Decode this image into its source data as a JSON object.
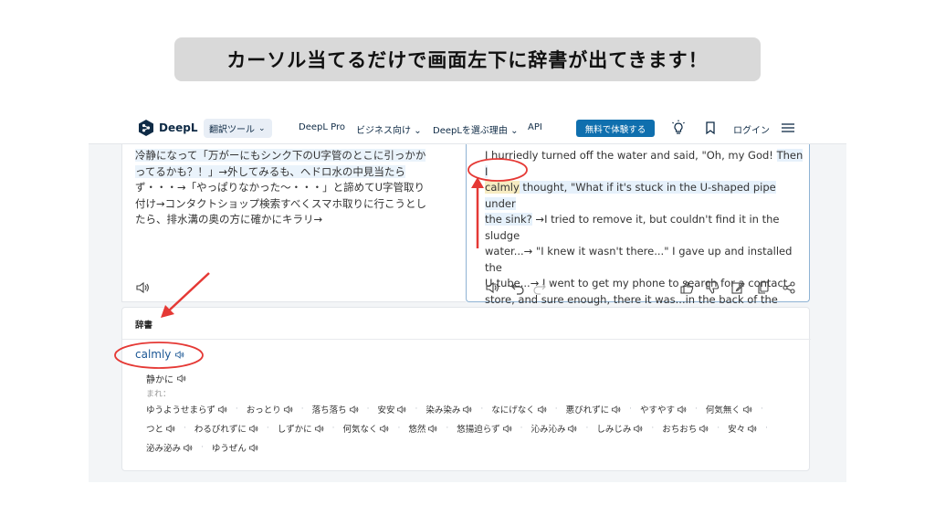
{
  "caption": "カーソル当てるだけで画面左下に辞書が出てきます！",
  "navbar": {
    "brand": "DeepL",
    "tool_dropdown": "翻訳ツール",
    "links": [
      "DeepL Pro",
      "ビジネス向け",
      "DeepLを選ぶ理由",
      "API"
    ],
    "try_button": "無料で体験する",
    "login": "ログイン",
    "icons": [
      "deepl-logo-icon",
      "lightbulb-icon",
      "bookmark-icon",
      "menu-icon"
    ]
  },
  "source": {
    "lines": [
      "冷静になって「万がーにもシンク下のU字管のとこに引っかか",
      "ってるかも？！」→外してみるも、ヘドロ水の中見当たら",
      "ず・・・→「やっぱりなかった〜・・・」と諦めてU字管取り",
      "付け→コンタクトショップ検索すべくスマホ取りに行こうとし",
      "たら、排水溝の奥の方に確かにキラリ→"
    ]
  },
  "target": {
    "line1_a": "I hurriedly turned off the water and said, \"Oh, my God! ",
    "line1_b": "Then I",
    "line2_word": "calmly",
    "line2_rest": " thought, \"What if it's stuck in the U-shaped pipe under",
    "line3_a": "the sink?",
    "line3_b": " →I tried to remove it, but couldn't find it in the sludge",
    "line4": "water...→ \"I knew it wasn't there...\" I gave up and installed the",
    "line5": "U-tube...→ I went to get my phone to search for a contact",
    "line6": "store, and sure enough, there it was...in the back of the drain..."
  },
  "dictionary": {
    "title": "辞書",
    "headword": "calmly",
    "meaning": "静かに",
    "rare_label": "まれ：",
    "synonyms_row1": [
      "ゆうようせまらず",
      "おっとり",
      "落ち落ち",
      "安安",
      "染み染み",
      "なにげなく",
      "悪びれずに",
      "やすやす",
      "何気無く"
    ],
    "synonyms_row2": [
      "つと",
      "わるびれずに",
      "しずかに",
      "何気なく",
      "悠然",
      "悠揚迫らず",
      "沁み沁み",
      "しみじみ",
      "おちおち",
      "安々"
    ],
    "synonyms_row3": [
      "泌み泌み",
      "ゆうぜん"
    ]
  },
  "colors": {
    "accent": "#0f6fae",
    "annotation": "#e53935",
    "highlight_word": "#f7ecc2"
  }
}
